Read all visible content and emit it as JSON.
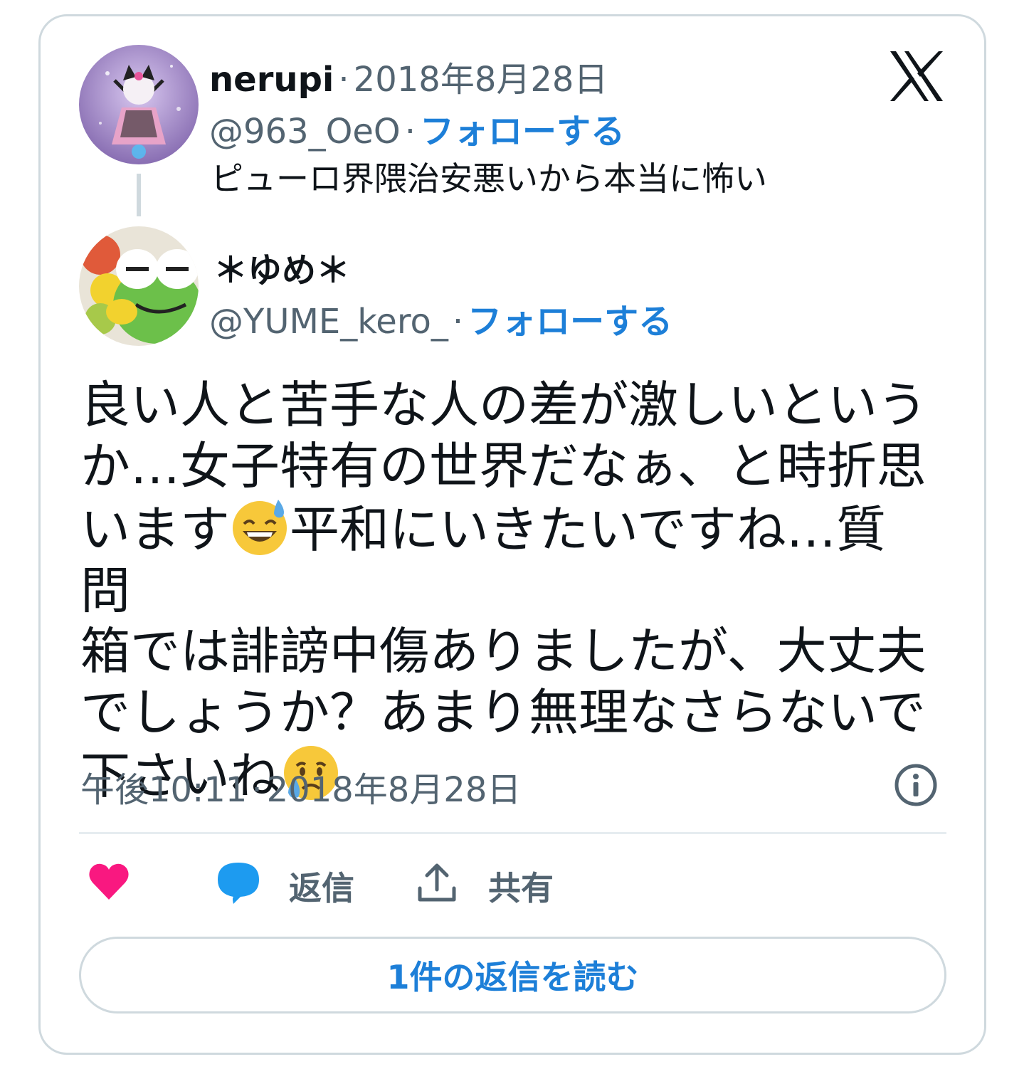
{
  "colors": {
    "link": "#1d7fd8",
    "muted": "#536471",
    "like": "#f91880",
    "reply": "#1d9bf0",
    "border": "#cfd9de"
  },
  "parent": {
    "name": "nerupi",
    "date": "2018年8月28日",
    "handle": "@963_OeO",
    "follow": "フォローする",
    "text": "ピューロ界隈治安悪いから本当に怖い"
  },
  "main": {
    "name": "＊ゆめ＊",
    "handle": "@YUME_kero_",
    "follow": "フォローする",
    "body": {
      "l1": "良い人と苦手な人の差が激しいという",
      "l2": "か…女子特有の世界だなぁ、と時折思",
      "l3a": "います",
      "l3b": "平和にいきたいですね…質問",
      "l4": "箱では誹謗中傷ありましたが、大丈夫",
      "l5": "でしょうか？あまり無理なさらないで",
      "l6": "下さいね"
    },
    "emoji1": "grinning-face-with-sweat",
    "emoji2": "crying-face",
    "time": "午後10:11",
    "date": "2018年8月28日"
  },
  "actions": {
    "reply": "返信",
    "share": "共有"
  },
  "read_replies": "1件の返信を読む",
  "icons": [
    "x-logo-icon",
    "info-icon",
    "heart-icon",
    "reply-bubble-icon",
    "share-icon"
  ]
}
